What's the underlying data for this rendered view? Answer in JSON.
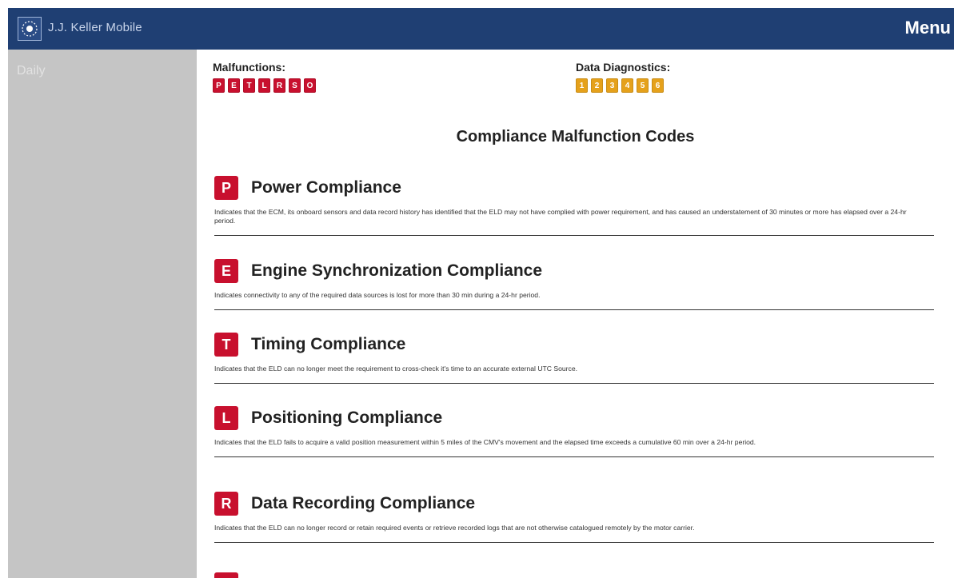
{
  "app": {
    "title": "J.J. Keller Mobile",
    "menu_label": "Menu"
  },
  "sidebar": {
    "items": [
      {
        "label": "Daily"
      }
    ]
  },
  "status": {
    "malfunctions": {
      "label": "Malfunctions:",
      "codes": [
        "P",
        "E",
        "T",
        "L",
        "R",
        "S",
        "O"
      ],
      "color": "#c8102e"
    },
    "diagnostics": {
      "label": "Data Diagnostics:",
      "codes": [
        "1",
        "2",
        "3",
        "4",
        "5",
        "6"
      ],
      "color": "#e5a11b"
    }
  },
  "section_title": "Compliance Malfunction Codes",
  "codes": [
    {
      "letter": "P",
      "title": "Power Compliance",
      "description": "Indicates that the ECM, its onboard sensors and data record history has identified that the ELD may not have complied with power requirement, and has caused an understatement of 30 minutes or more has elapsed over a 24-hr period."
    },
    {
      "letter": "E",
      "title": "Engine Synchronization Compliance",
      "description": "Indicates connectivity to any of the required data sources is lost for more than 30 min during a 24-hr period."
    },
    {
      "letter": "T",
      "title": "Timing Compliance",
      "description": "Indicates that the ELD can no longer meet the requirement to cross-check it's time to an accurate external UTC Source."
    },
    {
      "letter": "L",
      "title": "Positioning Compliance",
      "description": "Indicates that the ELD fails to acquire a valid position measurement within 5 miles of the CMV's movement and the elapsed time exceeds a cumulative 60 min over a 24-hr period."
    },
    {
      "letter": "R",
      "title": "Data Recording Compliance",
      "description": "Indicates that the ELD can no longer record or retain required events or retrieve recorded logs that are not otherwise catalogued remotely by the motor carrier."
    }
  ],
  "colors": {
    "header": "#1f3f73",
    "sidebar": "#c5c5c5",
    "malfunction_red": "#c8102e",
    "diagnostic_orange": "#e5a11b"
  }
}
